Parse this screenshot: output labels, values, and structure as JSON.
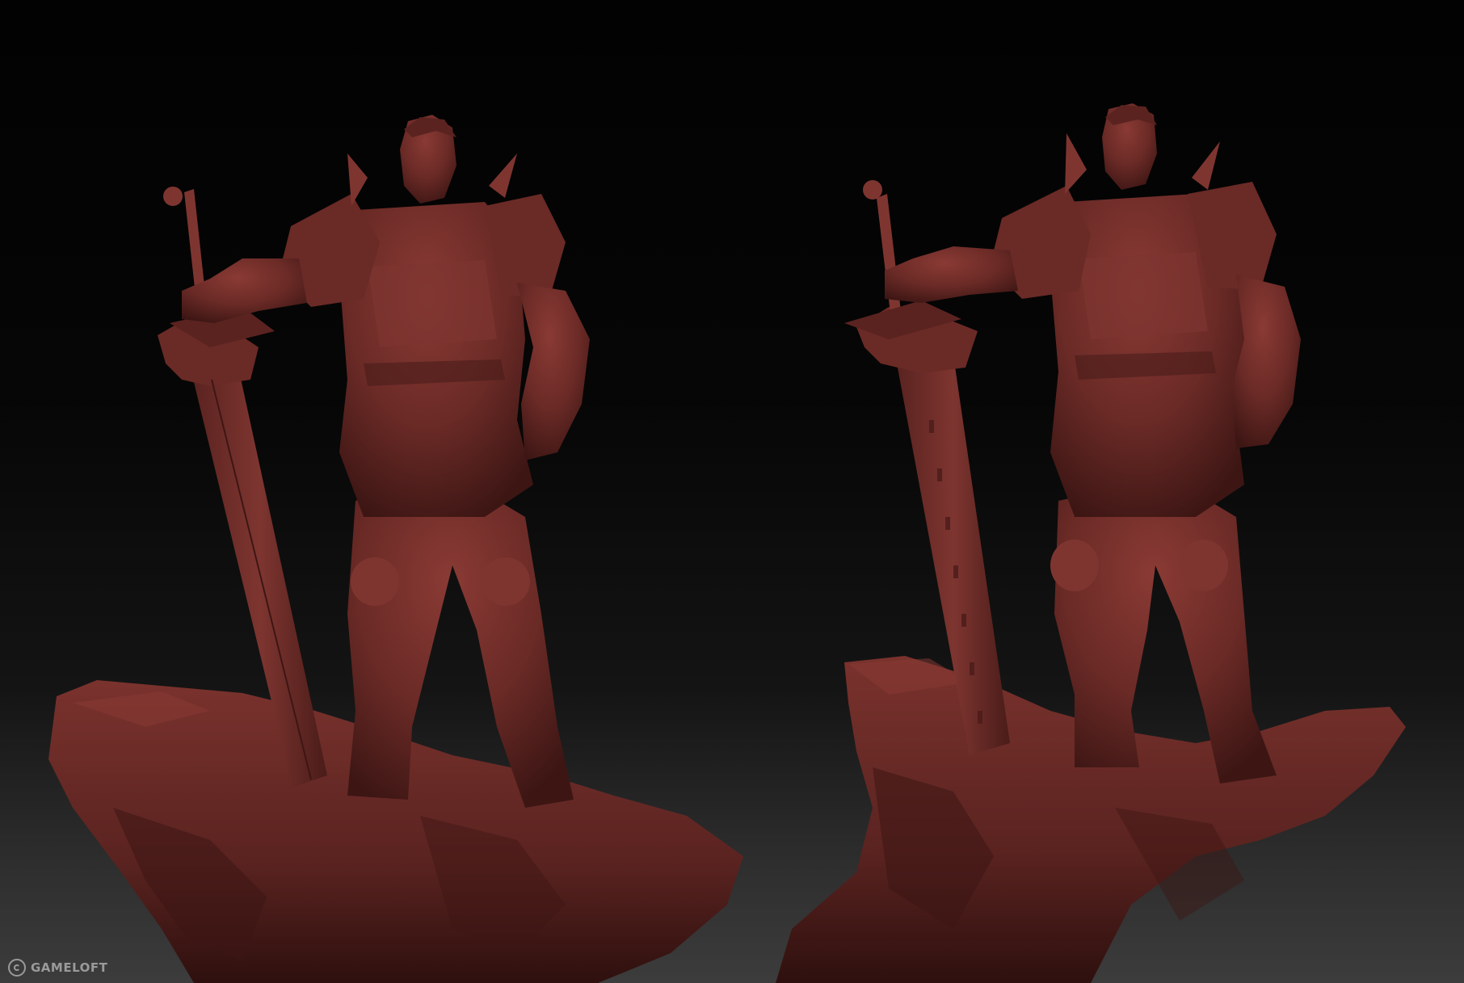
{
  "scene": {
    "subjects": [
      "armored-knight-front-view",
      "armored-knight-three-quarter-view"
    ]
  },
  "watermark": {
    "brand": "GAMELOFT",
    "icon": "gameloft-logo-icon"
  },
  "colors": {
    "clay": "#6a2a26",
    "clay_light": "#8a3a34",
    "clay_dark": "#3d1614",
    "background_top": "#020202",
    "background_bottom": "#3c3c3c"
  }
}
